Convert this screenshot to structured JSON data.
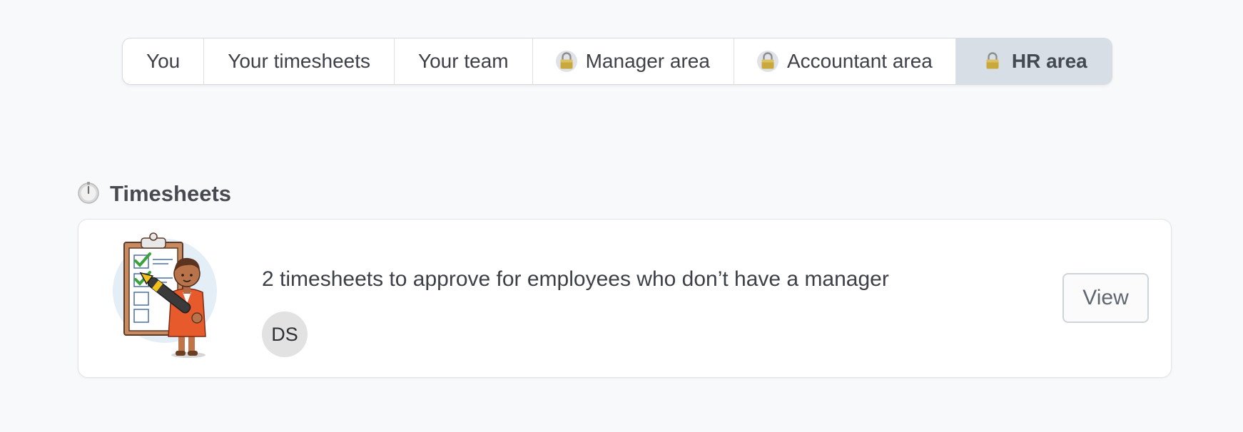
{
  "tabs": [
    {
      "label": "You",
      "locked": false,
      "active": false
    },
    {
      "label": "Your timesheets",
      "locked": false,
      "active": false
    },
    {
      "label": "Your team",
      "locked": false,
      "active": false
    },
    {
      "label": "Manager area",
      "locked": true,
      "active": false
    },
    {
      "label": "Accountant area",
      "locked": true,
      "active": false
    },
    {
      "label": "HR area",
      "locked": true,
      "active": true
    }
  ],
  "section": {
    "title": "Timesheets",
    "icon": "stopwatch-icon"
  },
  "card": {
    "illustration": "clipboard-checklist-person-illustration",
    "message": "2 timesheets to approve for employees who don’t have a manager",
    "avatar_initials": "DS",
    "view_label": "View"
  },
  "colors": {
    "background": "#f8f9fb",
    "active_tab": "#d8dee6",
    "avatar_bg": "#e2e2e2"
  }
}
